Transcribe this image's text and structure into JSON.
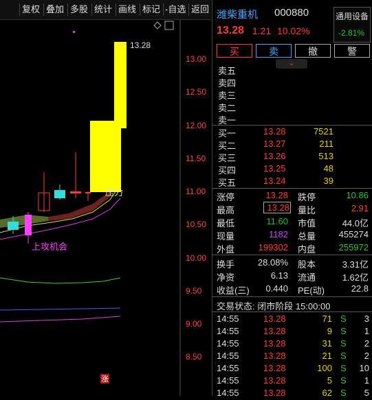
{
  "toolbar": {
    "items": [
      "复权",
      "叠加",
      "多股",
      "统计",
      "画线",
      "标记",
      "-自选",
      "返回"
    ]
  },
  "chart": {
    "price_axis": [
      "13.00",
      "12.50",
      "12.00",
      "11.50",
      "11.00",
      "10.50",
      "10.00",
      "9.50",
      "9.00",
      "8.50"
    ],
    "high_label": "13.28",
    "pressure_label": "压力",
    "signal_label": "上攻机会",
    "bottom_marker": "涨",
    "colors": {
      "up": "#ff3b3b",
      "down": "#33dddd",
      "limit_up": "#ffff00",
      "signal": "#ff40ff"
    }
  },
  "quote": {
    "name": "潍柴重机",
    "code": "000880",
    "price": "13.28",
    "change": "1.21",
    "change_pct": "10.02%",
    "settings_label": "通用设备",
    "settings_pct": "-2.81%",
    "buttons": {
      "buy": "买",
      "sell": "卖",
      "cancel": "撤",
      "alert": "警"
    }
  },
  "orderbook": {
    "asks": [
      {
        "label": "卖五",
        "price": "",
        "vol": ""
      },
      {
        "label": "卖四",
        "price": "",
        "vol": ""
      },
      {
        "label": "卖三",
        "price": "",
        "vol": ""
      },
      {
        "label": "卖二",
        "price": "",
        "vol": ""
      },
      {
        "label": "卖一",
        "price": "",
        "vol": ""
      }
    ],
    "bids": [
      {
        "label": "买一",
        "price": "13.28",
        "vol": "7521"
      },
      {
        "label": "买二",
        "price": "13.27",
        "vol": "211"
      },
      {
        "label": "买三",
        "price": "13.26",
        "vol": "513"
      },
      {
        "label": "买四",
        "price": "13.25",
        "vol": "48"
      },
      {
        "label": "买五",
        "price": "13.24",
        "vol": "39"
      }
    ]
  },
  "stats": [
    {
      "l1": "涨停",
      "v1": "13.28",
      "c1": "red",
      "l2": "跌停",
      "v2": "10.86",
      "c2": "green"
    },
    {
      "l1": "最高",
      "v1": "13.28",
      "c1": "red",
      "l2": "量比",
      "v2": "2.91",
      "c2": "red"
    },
    {
      "l1": "最低",
      "v1": "11.60",
      "c1": "green",
      "l2": "市值",
      "v2": "44.0亿",
      "c2": "wht"
    },
    {
      "l1": "现量",
      "v1": "1182",
      "c1": "mag",
      "l2": "总量",
      "v2": "455274",
      "c2": "wht"
    },
    {
      "l1": "外盘",
      "v1": "199302",
      "c1": "red",
      "l2": "内盘",
      "v2": "255972",
      "c2": "green"
    }
  ],
  "fund": [
    {
      "l1": "换手",
      "v1": "28.08%",
      "l2": "股本",
      "v2": "3.31亿"
    },
    {
      "l1": "净资",
      "v1": "6.13",
      "l2": "流通",
      "v2": "1.62亿"
    },
    {
      "l1": "收益(三)",
      "v1": "0.440",
      "l2": "PE(动)",
      "v2": "22.8"
    }
  ],
  "trade_status": "交易状态: 闭市阶段 15:00:00",
  "ticks": [
    {
      "time": "14:55",
      "price": "13.28",
      "vol": "71",
      "side": "S",
      "n": "3"
    },
    {
      "time": "14:55",
      "price": "13.28",
      "vol": "9",
      "side": "S",
      "n": "1"
    },
    {
      "time": "14:55",
      "price": "13.28",
      "vol": "31",
      "side": "S",
      "n": "2"
    },
    {
      "time": "14:55",
      "price": "13.28",
      "vol": "21",
      "side": "S",
      "n": "2"
    },
    {
      "time": "14:55",
      "price": "13.28",
      "vol": "100",
      "side": "S",
      "n": "10"
    },
    {
      "time": "14:55",
      "price": "13.28",
      "vol": "5",
      "side": "S",
      "n": "1"
    },
    {
      "time": "14:55",
      "price": "13.28",
      "vol": "62",
      "side": "S",
      "n": "5"
    }
  ]
}
